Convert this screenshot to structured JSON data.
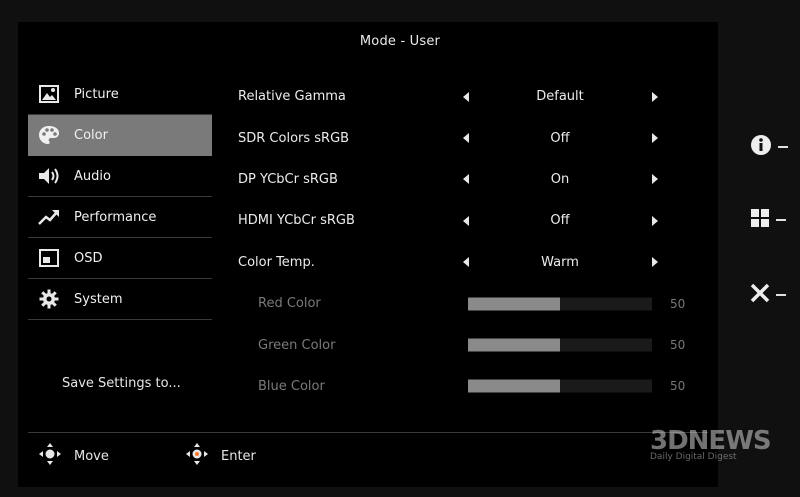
{
  "header": {
    "title": "Mode - User"
  },
  "sidebar": {
    "items": [
      {
        "label": "Picture",
        "icon": "picture-icon",
        "active": false
      },
      {
        "label": "Color",
        "icon": "palette-icon",
        "active": true
      },
      {
        "label": "Audio",
        "icon": "speaker-icon",
        "active": false
      },
      {
        "label": "Performance",
        "icon": "trend-arrow-icon",
        "active": false
      },
      {
        "label": "OSD",
        "icon": "osd-window-icon",
        "active": false
      },
      {
        "label": "System",
        "icon": "gear-icon",
        "active": false
      }
    ],
    "save_settings": "Save Settings to..."
  },
  "settings": [
    {
      "label": "Relative Gamma",
      "value": "Default"
    },
    {
      "label": "SDR Colors sRGB",
      "value": "Off"
    },
    {
      "label": "DP YCbCr sRGB",
      "value": "On"
    },
    {
      "label": "HDMI YCbCr sRGB",
      "value": "Off"
    },
    {
      "label": "Color Temp.",
      "value": "Warm"
    }
  ],
  "color_sliders": [
    {
      "label": "Red Color",
      "value": "50",
      "level": 0.5
    },
    {
      "label": "Green Color",
      "value": "50",
      "level": 0.5
    },
    {
      "label": "Blue Color",
      "value": "50",
      "level": 0.5
    }
  ],
  "footer": {
    "move_label": "Move",
    "enter_label": "Enter"
  },
  "side_buttons": [
    "info-icon",
    "grid-icon",
    "close-icon"
  ],
  "watermark": {
    "main": "3DNEWS",
    "sub": "Daily Digital Digest"
  },
  "colors": {
    "active_bg": "#7a7a7a",
    "bar_fill": "#8a8a8a",
    "panel_bg": "#000000"
  }
}
